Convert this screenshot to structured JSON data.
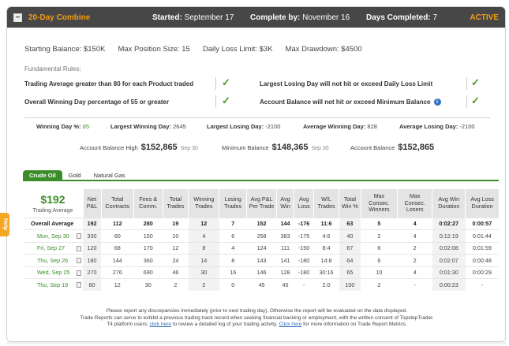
{
  "header": {
    "collapse_icon": "minus-icon",
    "title": "20-Day Combine",
    "started_label": "Started:",
    "started_value": "September 17",
    "complete_label": "Complete by:",
    "complete_value": "November 16",
    "days_label": "Days Completed:",
    "days_value": "7",
    "status": "ACTIVE"
  },
  "params": [
    "Starting Balance: $150K",
    "Max Position Size: 15",
    "Daily Loss Limit: $3K",
    "Max Drawdown: $4500"
  ],
  "fundamental_rules_label": "Fundamental Rules:",
  "rules": [
    "Trading Average greater than 80 for each Product traded",
    "Largest Losing Day will not hit or exceed Daily Loss Limit",
    "Overall Winning Day percentage of 55 or greater",
    "Account Balance will not hit or exceed Minimum Balance"
  ],
  "stats": {
    "winning_day_pct_label": "Winning Day %:",
    "winning_day_pct_value": "85",
    "largest_winning_day_label": "Largest Winning Day:",
    "largest_winning_day_value": "2645",
    "largest_losing_day_label": "Largest Losing Day:",
    "largest_losing_day_value": "-2100",
    "avg_winning_day_label": "Average Winning Day:",
    "avg_winning_day_value": "828",
    "avg_losing_day_label": "Average Losing Day:",
    "avg_losing_day_value": "-2100"
  },
  "balances": {
    "high_label": "Account Balance High",
    "high_value": "$152,865",
    "high_date": "Sep 30",
    "min_label": "Minimum Balance",
    "min_value": "$148,365",
    "min_date": "Sep 30",
    "acct_label": "Account Balance",
    "acct_value": "$152,865"
  },
  "tabs": [
    "Crude Oil",
    "Gold",
    "Natural Gas"
  ],
  "summary": {
    "amount": "$192",
    "label": "Trading Average"
  },
  "table": {
    "headers": [
      "Net P&L",
      "Total Contracts",
      "Fees & Comm.",
      "Total Trades",
      "Winning Trades",
      "Losing Trades",
      "Avg P&L Per Trade",
      "Avg Win",
      "Avg Loss",
      "W/L Trades",
      "Total Win %",
      "Max Consec. Winners",
      "Max Consec. Losers",
      "Avg Win Duration",
      "Avg Loss Duration"
    ],
    "overall": {
      "label": "Overall Average",
      "cells": [
        "192",
        "112",
        "280",
        "19",
        "12",
        "7",
        "152",
        "144",
        "-176",
        "11:6",
        "63",
        "5",
        "4",
        "0:02:27",
        "0:00:57"
      ]
    },
    "rows": [
      {
        "date": "Mon, Sep 30",
        "cells": [
          "330",
          "60",
          "150",
          "10",
          "4",
          "6",
          "258",
          "383",
          "-175",
          "4:6",
          "40",
          "2",
          "4",
          "0:12:19",
          "0:01:44"
        ]
      },
      {
        "date": "Fri, Sep 27",
        "cells": [
          "120",
          "68",
          "170",
          "12",
          "8",
          "4",
          "124",
          "111",
          "-150",
          "8:4",
          "67",
          "6",
          "2",
          "0:02:08",
          "0:01:59"
        ]
      },
      {
        "date": "Thu, Sep 26",
        "cells": [
          "180",
          "144",
          "360",
          "24",
          "14",
          "8",
          "143",
          "141",
          "-180",
          "14:8",
          "64",
          "6",
          "2",
          "0:02:07",
          "0:00:48"
        ]
      },
      {
        "date": "Wed, Sep 25",
        "cells": [
          "270",
          "276",
          "690",
          "46",
          "30",
          "16",
          "146",
          "128",
          "-180",
          "30:16",
          "65",
          "10",
          "4",
          "0:01:30",
          "0:00:29"
        ]
      },
      {
        "date": "Thu, Sep 19",
        "cells": [
          "60",
          "12",
          "30",
          "2",
          "2",
          "0",
          "45",
          "45",
          "-",
          "2:0",
          "100",
          "2",
          "-",
          "0:00:23",
          "-"
        ]
      }
    ]
  },
  "footer": {
    "line1": "Please report any discrepancies immediately (prior to next trading day). Otherwise the report will be evaluated on the data displayed.",
    "line2": "Trade Reports can serve to exhibit a previous trading track record when seeking financial backing or employment, with the written consent of TopstepTrader.",
    "line3_pre": "T4 platform users;",
    "link1": "click here",
    "line3_mid": "to review a detailed log of your trading activity.",
    "link2": "Click here",
    "line3_post": "for more information on Trade Report Metrics."
  },
  "side_tab": "Help"
}
